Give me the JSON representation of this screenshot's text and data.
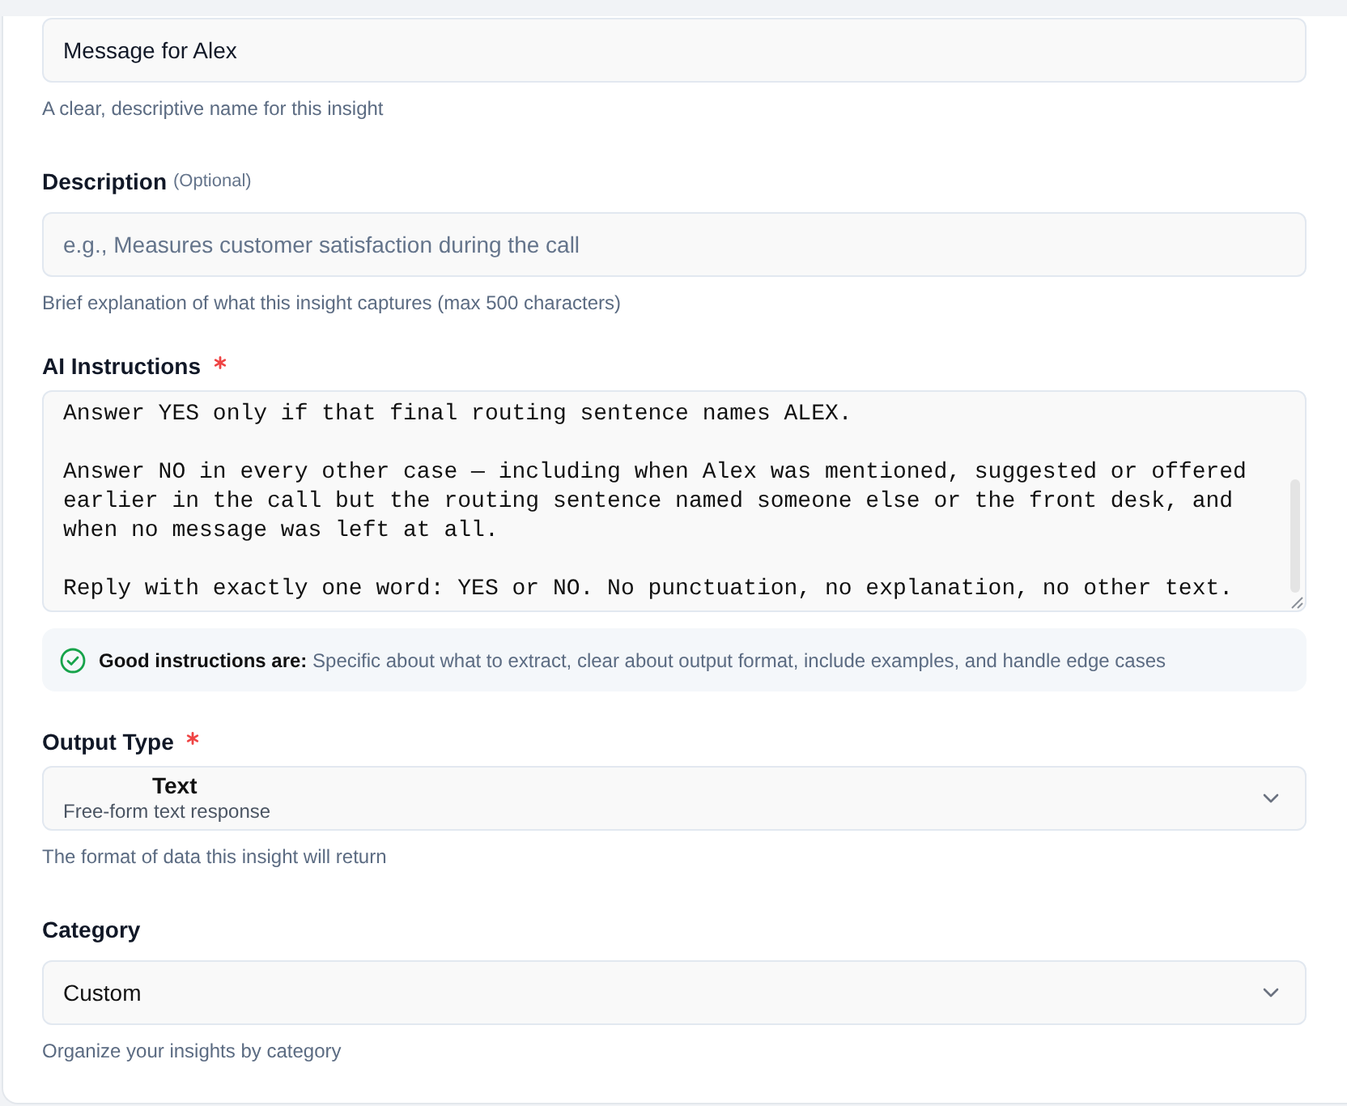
{
  "fields": [
    {
      "kind": "text",
      "value": "Message for Alex",
      "help": "A clear, descriptive name for this insight"
    },
    {
      "kind": "text",
      "label": "Description",
      "optional_note": "(Optional)",
      "required": false,
      "placeholder": "e.g., Measures customer satisfaction during the call",
      "help": "Brief explanation of what this insight captures (max 500 characters)"
    },
    {
      "kind": "textarea",
      "label": "AI Instructions",
      "required": true,
      "value": "Answer YES only if that final routing sentence names ALEX.\n\nAnswer NO in every other case — including when Alex was mentioned, suggested or offered earlier in the call but the routing sentence named someone else or the front desk, and when no message was left at all.\n\nReply with exactly one word: YES or NO. No punctuation, no explanation, no other text.",
      "tip": "**Good instructions are:** Specific about what to extract, clear about output format, include examples, and handle edge cases"
    },
    {
      "kind": "select",
      "label": "Output Type",
      "required": true,
      "value": "Text",
      "description": "Free-form text response",
      "help": "The format of data this insight will return"
    },
    {
      "kind": "select",
      "label": "Category",
      "required": false,
      "value": "Custom",
      "help": "Organize your insights by category"
    }
  ]
}
